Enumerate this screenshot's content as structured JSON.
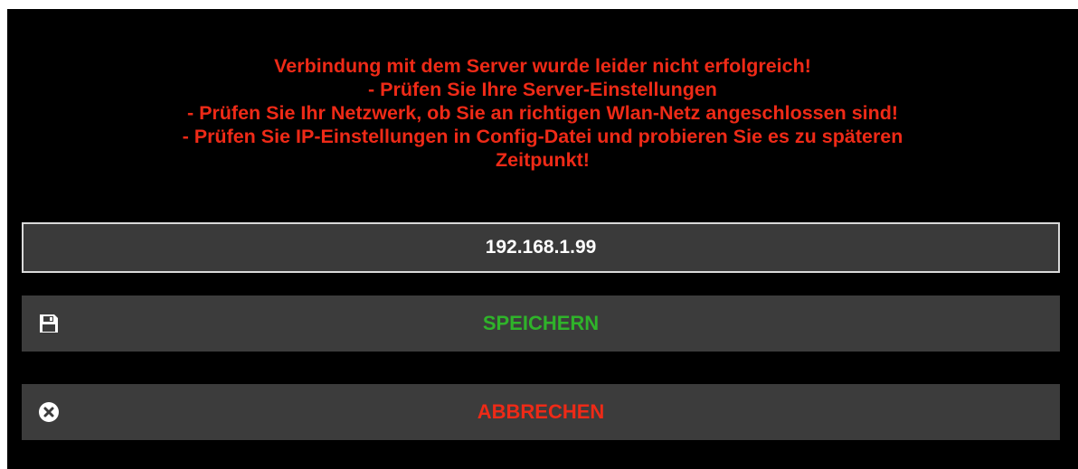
{
  "dialog": {
    "message_lines": [
      "Verbindung mit dem Server wurde leider nicht erfolgreich!",
      "- Prüfen Sie Ihre Server-Einstellungen",
      "- Prüfen Sie Ihr Netzwerk, ob Sie an richtigen Wlan-Netz angeschlossen sind!",
      "- Prüfen Sie IP-Einstellungen in Config-Datei und probieren Sie es zu späteren",
      "Zeitpunkt!"
    ],
    "message_color": "#ee2a17",
    "ip_field": {
      "value": "192.168.1.99"
    },
    "save_button": {
      "label": "SPEICHERN",
      "icon": "floppy-disk-icon",
      "color": "#2fb32a"
    },
    "cancel_button": {
      "label": "ABBRECHEN",
      "icon": "close-circle-icon",
      "color": "#ee2a17"
    }
  }
}
